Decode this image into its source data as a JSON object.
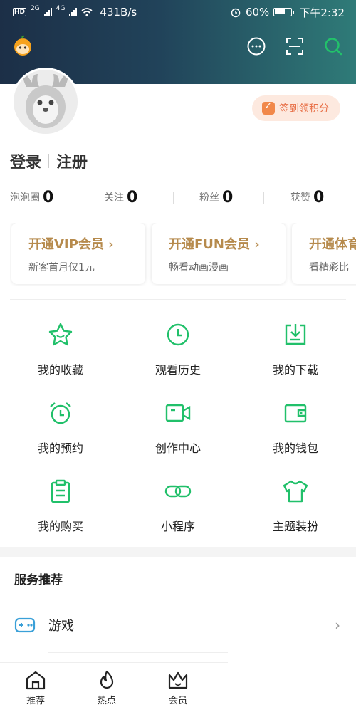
{
  "status_bar": {
    "hd_label": "HD",
    "net1": "2G",
    "net2": "4G",
    "speed": "431B/s",
    "battery": "60%",
    "time": "下午2:32"
  },
  "top_bar": {
    "icons": [
      "app-logo",
      "message-icon",
      "scan-icon",
      "search-icon"
    ]
  },
  "profile": {
    "checkin_label": "签到领积分",
    "login_label": "登录",
    "register_label": "注册"
  },
  "stats": [
    {
      "label": "泡泡圈",
      "value": "0"
    },
    {
      "label": "关注",
      "value": "0"
    },
    {
      "label": "粉丝",
      "value": "0"
    },
    {
      "label": "获赞",
      "value": "0"
    }
  ],
  "vip_cards": [
    {
      "title": "开通VIP会员 ›",
      "sub": "新客首月仅1元"
    },
    {
      "title": "开通FUN会员 ›",
      "sub": "畅看动画漫画"
    },
    {
      "title": "开通体育",
      "sub": "看精彩比"
    }
  ],
  "grid": [
    {
      "label": "我的收藏",
      "icon": "star-icon"
    },
    {
      "label": "观看历史",
      "icon": "clock-icon"
    },
    {
      "label": "我的下载",
      "icon": "download-icon"
    },
    {
      "label": "我的预约",
      "icon": "alarm-icon"
    },
    {
      "label": "创作中心",
      "icon": "video-camera-icon"
    },
    {
      "label": "我的钱包",
      "icon": "wallet-icon"
    },
    {
      "label": "我的购买",
      "icon": "clipboard-icon"
    },
    {
      "label": "小程序",
      "icon": "link-icon"
    },
    {
      "label": "主题装扮",
      "icon": "tshirt-icon"
    }
  ],
  "services": {
    "title": "服务推荐",
    "items": [
      {
        "label": "游戏",
        "icon": "gamepad-icon"
      }
    ]
  },
  "tabbar": [
    {
      "label": "推荐",
      "icon": "home-icon"
    },
    {
      "label": "热点",
      "icon": "flame-icon"
    },
    {
      "label": "会员",
      "icon": "crown-icon"
    }
  ],
  "colors": {
    "accent_green": "#21c06a",
    "vip_gold": "#b68a4c",
    "checkin_orange": "#e87048"
  }
}
